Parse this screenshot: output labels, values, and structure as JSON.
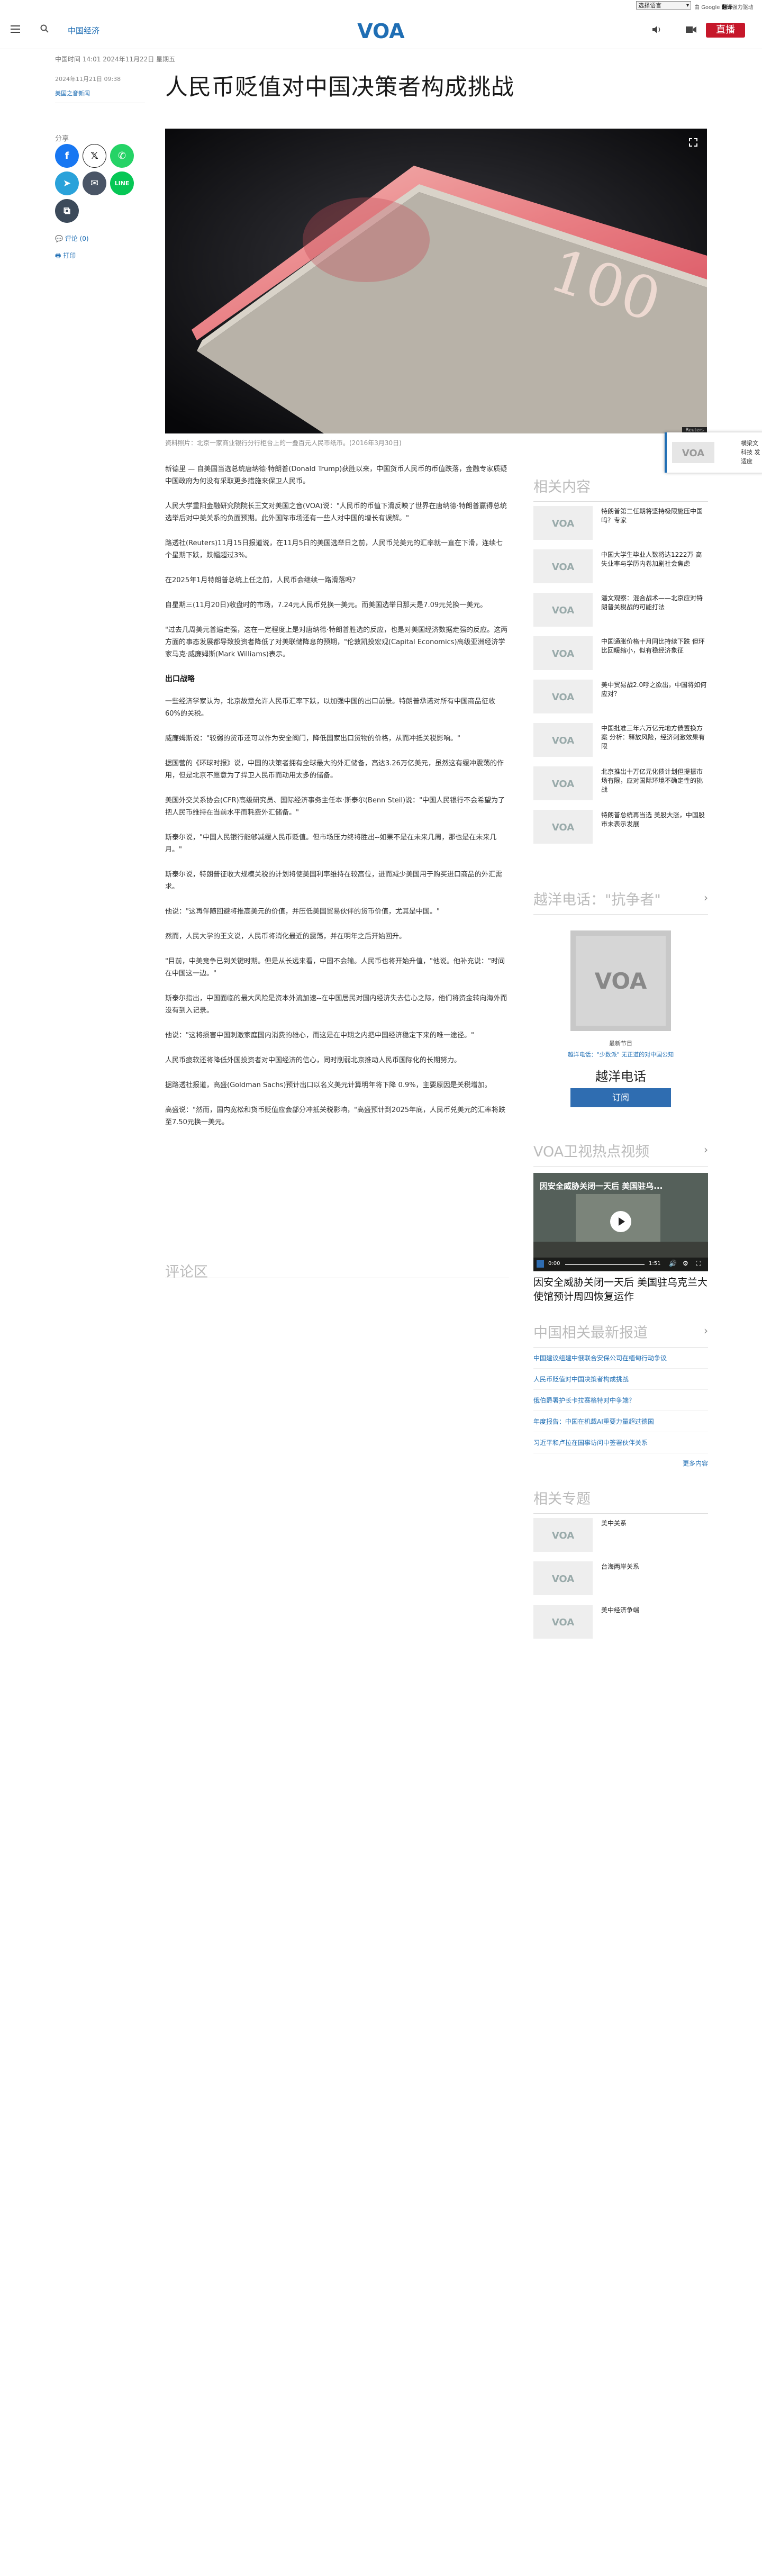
{
  "translate": {
    "select_label": "选择语言",
    "powered_prefix": "由",
    "powered_google": "Google",
    "powered_brand": "翻译",
    "powered_suffix": "强力驱动"
  },
  "header": {
    "section": "中国经济",
    "logo": "VOA",
    "live": "直播"
  },
  "article": {
    "dateline": "中国时间 14:01 2024年11月22日 星期五",
    "date": "2024年11月21日 09:38",
    "author": "美国之音新闻",
    "title": "人民币贬值对中国决策者构成挑战",
    "share_label": "分享",
    "comments_link": "评论 (0)",
    "print_link": "打印",
    "photo_credit": "Reuters",
    "caption": "资料照片：北京一家商业银行分行柜台上的一叠百元人民币纸币。(2016年3月30日)",
    "paragraphs": [
      "新德里 — 自美国当选总统唐纳德·特朗普(Donald Trump)获胜以来，中国货币人民币的币值跌落，金融专家质疑中国政府为何没有采取更多措施来保卫人民币。",
      "人民大学重阳金融研究院院长王文对美国之音(VOA)说：\"人民币的币值下滑反映了世界在唐纳德·特朗普赢得总统选举后对中美关系的负面预期。此外国际市场还有一些人对中国的增长有误解。\"",
      "路透社(Reuters)11月15日报道说，在11月5日的美国选举日之前，人民币兑美元的汇率就一直在下滑，连续七个星期下跌，跌幅超过3%。",
      "在2025年1月特朗普总统上任之前，人民币会继续一路滑落吗？",
      "自星期三(11月20日)收盘时的市场，7.24元人民币兑换一美元。而美国选举日那天是7.09元兑换一美元。",
      "\"过去几周美元普遍走强，这在一定程度上是对唐纳德·特朗普胜选的反应，也是对美国经济数据走强的反应。这两方面的事态发展都导致投资者降低了对美联储降息的预期，\"伦敦凯投宏观(Capital Economics)高级亚洲经济学家马克·威廉姆斯(Mark Williams)表示。",
      "一些经济学家认为，北京故意允许人民币汇率下跌，以加强中国的出口前景。特朗普承诺对所有中国商品征收60%的关税。",
      "威廉姆斯说：\"较弱的货币还可以作为安全阀门，降低国家出口货物的价格，从而冲抵关税影响。\"",
      "据国营的《环球时报》说，中国的决策者拥有全球最大的外汇储备，高达3.26万亿美元，虽然这有缓冲震荡的作用，但是北京不愿意为了捍卫人民币而动用太多的储备。",
      "美国外交关系协会(CFR)高级研究员、国际经济事务主任本·斯泰尔(Benn Steil)说：\"中国人民银行不会希望为了把人民币维持在当前水平而耗费外汇储备。\"",
      "斯泰尔说，\"中国人民银行能够减缓人民币贬值。但市场压力终将胜出--如果不是在未来几周，那也是在未来几月。\"",
      "斯泰尔说，特朗普征收大规模关税的计划将使美国利率维持在较高位，进而减少美国用于购买进口商品的外汇需求。",
      "他说：\"这再伴随回避将推高美元的价值，并压低美国贸易伙伴的货币价值，尤其是中国。\"",
      "然而，人民大学的王文说，人民币将消化最近的震荡，并在明年之后开始回升。",
      "\"目前，中美竞争已到关键时期。但是从长远来看，中国不会输。人民币也将开始升值，\"他说。他补充说：\"时间在中国这一边。\"",
      "斯泰尔指出，中国面临的最大风险是资本外流加速--在中国居民对国内经济失去信心之际，他们将资金转向海外而没有到入记录。",
      "他说：\"这将损害中国刺激家庭国内消费的雄心，而这是在中期之内把中国经济稳定下来的唯一途径。\"",
      "人民币疲软还将降低外国投资者对中国经济的信心，同时削弱北京推动人民币国际化的长期努力。",
      "据路透社报道，高盛(Goldman Sachs)预计出口以名义美元计算明年将下降 0.9%，主要原因是关税增加。",
      "高盛说：\"然而，国内宽松和货币贬值应会部分冲抵关税影响，\"高盛预计到2025年底，人民币兑美元的汇率将跌至7.50元换一美元。"
    ],
    "subhead": "出口战略",
    "comments_title": "评论区"
  },
  "rail": {
    "related_title": "相关内容",
    "related": [
      "特朗普第二任期将坚持极限施压中国吗？专家",
      "中国大学生毕业人数将达1222万 高失业率与学历内卷加剧社会焦虑",
      "潘文观察：混合战术——北京应对特朗普关税战的可能打法",
      "中国通胀价格十月同比持续下跌 但环比回暖缩小，似有稳经济象征",
      "美中贸易战2.0呼之欲出，中国将如何应对？",
      "中国批准三年六万亿元地方债置换方案 分析：释放风险，经济刺激效果有限",
      "北京推出十万亿元化债计划但提振市场有限，应对国际环境不确定性的挑战",
      "特朗普总统再当选 美股大涨，中国股市未表示发展"
    ],
    "hotline_title": "越洋电话：\"抗争者\"",
    "hotline_tag": "最新节目",
    "hotline_link": "越洋电话：\"少数派\" 无正道的对中国公知",
    "hotline_name": "越洋电话",
    "subscribe": "订阅",
    "video_title_section": "VOA卫视热点视频",
    "video_overlay": "因安全威胁关闭一天后 美国驻乌...",
    "video_time_current": "0:00",
    "video_time_total": "1:51",
    "video_caption": "因安全威胁关闭一天后 美国驻乌克兰大使馆预计周四恢复运作",
    "china_news_title": "中国相关最新报道",
    "china_news": [
      "中国建议组建中俄联合安保公司在缅甸行动争议",
      "人民币贬值对中国决策者构成挑战",
      "俄伯爵署护长卡拉赛格特对中争端？",
      "年度报告：中国在机载AI重要力量超过德国",
      "习近平和卢拉在国事访问中签署伙伴关系"
    ],
    "more": "更多内容",
    "topics_title": "相关专题",
    "topics": [
      "美中关系",
      "台海两岸关系",
      "美中经济争端"
    ]
  },
  "widget": {
    "line1": "横梁文",
    "line2": "科技 发",
    "line3": "适度"
  },
  "colors": {
    "brand_blue": "#1f6eb4",
    "live_red": "#c6172a"
  }
}
